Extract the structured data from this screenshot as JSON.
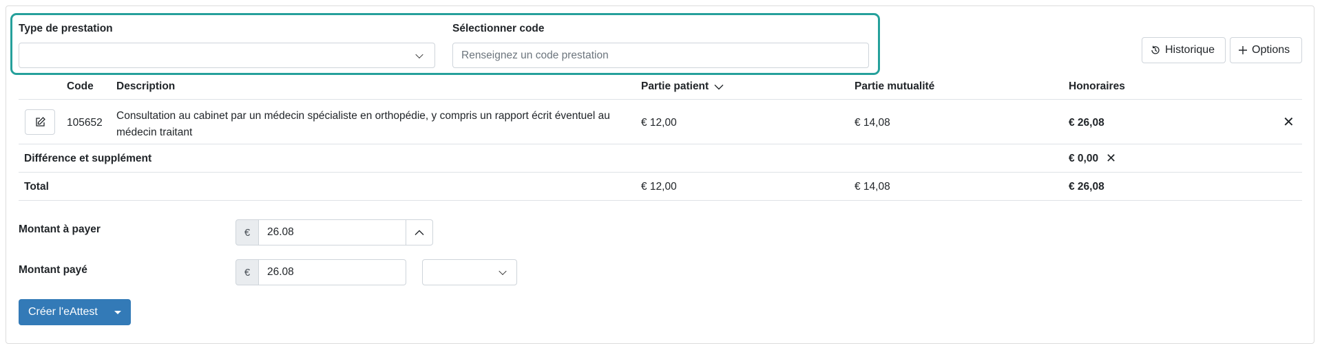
{
  "filters": {
    "type_label": "Type de prestation",
    "type_value": "",
    "code_label": "Sélectionner code",
    "code_placeholder": "Renseignez un code prestation"
  },
  "toolbar": {
    "history_label": "Historique",
    "options_label": "Options"
  },
  "table": {
    "headers": {
      "code": "Code",
      "description": "Description",
      "patient": "Partie patient",
      "mutuality": "Partie mutualité",
      "fees": "Honoraires"
    },
    "rows": [
      {
        "code": "105652",
        "description_line1": "Consultation au cabinet par un médecin spécialiste en orthopédie, y compris un rapport écrit éventuel au",
        "description_line2": "médecin traitant",
        "patient": "€ 12,00",
        "mutuality": "€ 14,08",
        "fees": "€ 26,08"
      }
    ],
    "supplement": {
      "label": "Différence et supplément",
      "fees": "€ 0,00"
    },
    "total": {
      "label": "Total",
      "patient": "€ 12,00",
      "mutuality": "€ 14,08",
      "fees": "€ 26,08"
    }
  },
  "payment": {
    "amount_due_label": "Montant à payer",
    "amount_due_currency": "€",
    "amount_due_value": "26.08",
    "amount_paid_label": "Montant payé",
    "amount_paid_currency": "€",
    "amount_paid_value": "26.08",
    "method_value": ""
  },
  "actions": {
    "create_label": "Créer l'eAttest"
  },
  "colors": {
    "highlight": "#25a09b",
    "primary": "#337ab7"
  },
  "icons": {
    "history": "history-icon",
    "options": "plus-icon",
    "edit": "edit-icon",
    "remove": "close-icon",
    "sort": "chevron-down-icon"
  }
}
